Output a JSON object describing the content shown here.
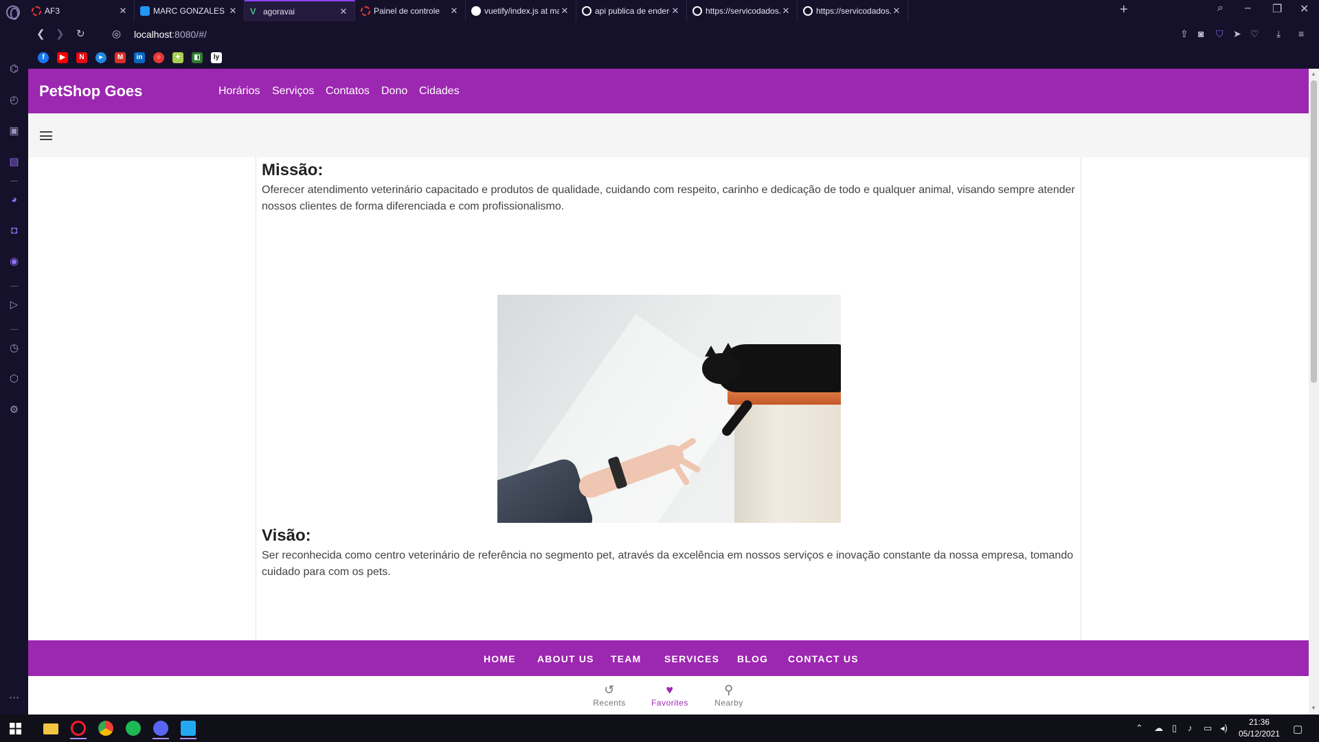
{
  "browser": {
    "tabs": [
      {
        "label": "AF3",
        "favicon_color": "#e53935",
        "active": false
      },
      {
        "label": "MARC GONZALES CAPDEV",
        "favicon_color": "#2196f3",
        "active": false
      },
      {
        "label": "agoravai",
        "favicon_color": "#41b883",
        "active": true
      },
      {
        "label": "Painel de controle",
        "favicon_color": "#e53935",
        "active": false
      },
      {
        "label": "vuetify/index.js at main · A",
        "favicon_color": "#ffffff",
        "active": false
      },
      {
        "label": "api publica de endereços ·",
        "favicon_color": "#ffffff",
        "active": false
      },
      {
        "label": "https://servicodados.ibge.g",
        "favicon_color": "#ffffff",
        "active": false
      },
      {
        "label": "https://servicodados.ibge.g",
        "favicon_color": "#ffffff",
        "active": false
      }
    ],
    "url_host": "localhost",
    "url_rest": ":8080/#/",
    "bookmarks": [
      {
        "name": "facebook",
        "color": "#1877f2",
        "glyph": "f"
      },
      {
        "name": "youtube",
        "color": "#ff0000",
        "glyph": "▶"
      },
      {
        "name": "netflix",
        "color": "#e50914",
        "glyph": "N"
      },
      {
        "name": "prime",
        "color": "#1e88e5",
        "glyph": "▸"
      },
      {
        "name": "gmail",
        "color": "#d93025",
        "glyph": "M"
      },
      {
        "name": "linkedin",
        "color": "#0a66c2",
        "glyph": "in"
      },
      {
        "name": "opera",
        "color": "#e53935",
        "glyph": "○"
      },
      {
        "name": "figma",
        "color": "#a6d04f",
        "glyph": "✦"
      },
      {
        "name": "code",
        "color": "#2e7d32",
        "glyph": "◧"
      },
      {
        "name": "ly",
        "color": "#ffffff",
        "glyph": "ly"
      }
    ]
  },
  "app": {
    "brand": "PetShop Goes",
    "nav": [
      "Horários",
      "Serviços",
      "Contatos",
      "Dono",
      "Cidades"
    ],
    "sections": [
      {
        "title": "Missão:",
        "text": "Oferecer atendimento veterinário capacitado e produtos de qualidade, cuidando com respeito, carinho e dedicação de todo e qualquer animal, visando sempre atender nossos clientes de forma diferenciada e com profissionalismo."
      },
      {
        "title": "Visão:",
        "text": "Ser reconhecida como centro veterinário de referência no segmento pet, através da excelência em nossos serviços e inovação constante da nossa empresa, tomando cuidado para com os pets."
      }
    ],
    "footer_links": [
      "HOME",
      "ABOUT US",
      "TEAM",
      "SERVICES",
      "BLOG",
      "CONTACT US"
    ],
    "bottom_nav": [
      {
        "label": "Recents",
        "icon": "history-icon",
        "glyph": "↺",
        "active": false
      },
      {
        "label": "Favorites",
        "icon": "heart-icon",
        "glyph": "♥",
        "active": true
      },
      {
        "label": "Nearby",
        "icon": "map-marker-icon",
        "glyph": "⬤",
        "active": false
      }
    ],
    "accent_color": "#9c27b0"
  },
  "taskbar": {
    "time": "21:36",
    "date": "05/12/2021",
    "apps": [
      {
        "name": "file-explorer",
        "color": "#f4c542",
        "running": false
      },
      {
        "name": "opera",
        "color": "#ff1b2d",
        "running": true
      },
      {
        "name": "chrome",
        "color": "#4caf50",
        "running": false
      },
      {
        "name": "spotify",
        "color": "#1db954",
        "running": false
      },
      {
        "name": "discord",
        "color": "#5865f2",
        "running": true
      },
      {
        "name": "vscode",
        "color": "#23a9f2",
        "running": true
      }
    ]
  }
}
